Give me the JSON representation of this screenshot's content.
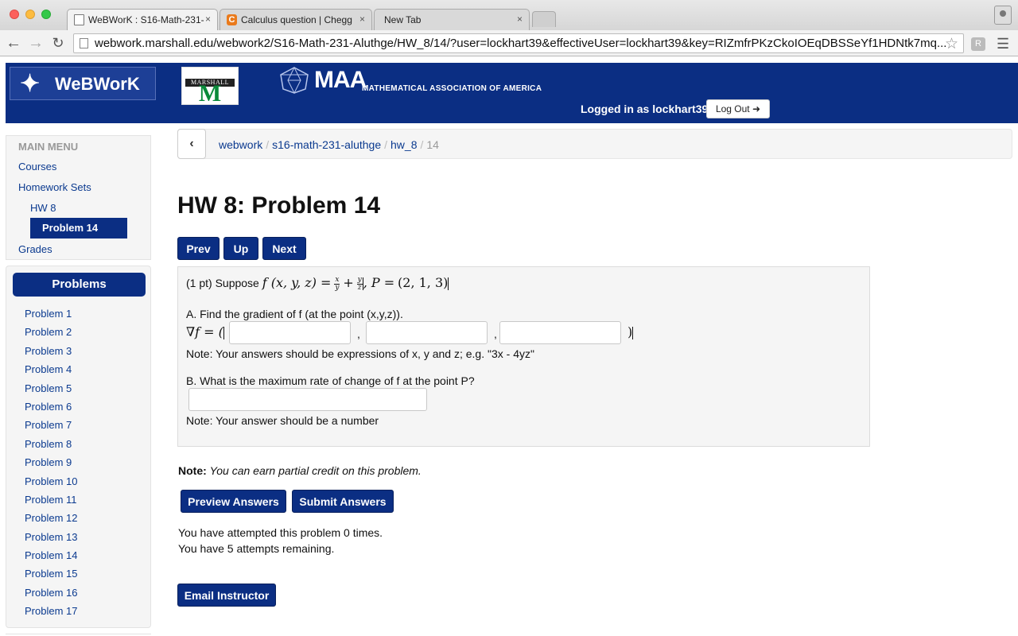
{
  "browser": {
    "tabs": [
      {
        "label": "WeBWorK : S16-Math-231-",
        "active": true
      },
      {
        "label": "Calculus question | Chegg",
        "active": false
      },
      {
        "label": "New Tab",
        "active": false
      }
    ],
    "close_glyph": "×",
    "url": "webwork.marshall.edu/webwork2/S16-Math-231-Aluthge/HW_8/14/?user=lockhart39&effectiveUser=lockhart39&key=RIZmfrPKzCkoIOEqDBSSeYf1HDNtk7mq..."
  },
  "header": {
    "logo_text": "WeBWorK",
    "marshall_band": "MARSHALL",
    "marshall_letter": "M",
    "maa_text": "MAA",
    "maa_subtitle": "MATHEMATICAL ASSOCIATION OF AMERICA",
    "login_text": "Logged in as lockhart39.",
    "logout_label": "Log Out"
  },
  "main_menu": {
    "heading": "MAIN MENU",
    "courses": "Courses",
    "homework_sets": "Homework Sets",
    "hw": "HW 8",
    "problem_active": "Problem 14",
    "grades": "Grades"
  },
  "problems_panel": {
    "heading": "Problems",
    "items": [
      "Problem 1",
      "Problem 2",
      "Problem 3",
      "Problem 4",
      "Problem 5",
      "Problem 6",
      "Problem 7",
      "Problem 8",
      "Problem 9",
      "Problem 10",
      "Problem 11",
      "Problem 12",
      "Problem 13",
      "Problem 14",
      "Problem 15",
      "Problem 16",
      "Problem 17"
    ]
  },
  "breadcrumb": {
    "back_glyph": "‹",
    "items": [
      "webwork",
      "s16-math-231-aluthge",
      "hw_8"
    ],
    "current": "14"
  },
  "page_title": "HW 8: Problem 14",
  "nav": {
    "prev": "Prev",
    "up": "Up",
    "next": "Next"
  },
  "problem": {
    "intro": "(1 pt) Suppose",
    "function_lhs": "f (x, y, z) =",
    "frac1": {
      "num": "x",
      "den": "y"
    },
    "plus": "+",
    "frac2": {
      "num": "y",
      "den": "z"
    },
    "point_label": ", P =",
    "point_value": "(2, 1, 3)",
    "part_a": "A. Find the gradient of f (at the point (x,y,z)).",
    "gradient_label": "∇f = (",
    "comma": ",",
    "close_paren": ")",
    "note_a": "Note: Your answers should be expressions of x, y and z; e.g. \"3x - 4yz\"",
    "part_b": "B. What is the maximum rate of change of f at the point P?",
    "note_b": "Note: Your answer should be a number"
  },
  "partial_note": {
    "bold": "Note:",
    "italic": "You can earn partial credit on this problem."
  },
  "actions": {
    "preview": "Preview Answers",
    "submit": "Submit Answers",
    "email": "Email Instructor"
  },
  "attempts": {
    "line1": "You have attempted this problem 0 times.",
    "line2": "You have 5 attempts remaining."
  }
}
